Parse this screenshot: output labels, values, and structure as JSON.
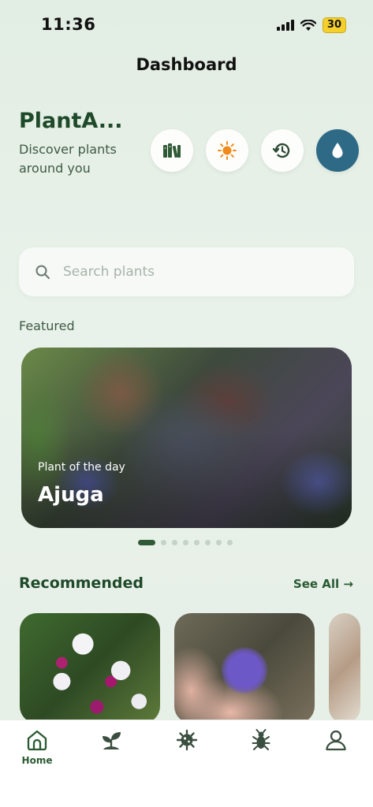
{
  "status_bar": {
    "time": "11:36",
    "battery": "30"
  },
  "header": {
    "title": "Dashboard"
  },
  "app": {
    "name": "PlantA...",
    "tagline": "Discover plants around you"
  },
  "quick_actions": [
    {
      "icon": "books-icon",
      "active": false
    },
    {
      "icon": "sun-icon",
      "active": false
    },
    {
      "icon": "history-icon",
      "active": false
    },
    {
      "icon": "water-drop-icon",
      "active": true
    }
  ],
  "search": {
    "placeholder": "Search plants",
    "value": ""
  },
  "featured": {
    "section_label": "Featured",
    "card": {
      "subtitle": "Plant of the day",
      "name": "Ajuga"
    },
    "pagination": {
      "count": 8,
      "active_index": 0
    }
  },
  "recommended": {
    "title": "Recommended",
    "see_all_label": "See All",
    "items": [
      {
        "image": "cattleya-orchid-photo"
      },
      {
        "image": "purple-flower-in-hand-photo"
      },
      {
        "image": "partial-plant-photo"
      }
    ]
  },
  "tab_bar": {
    "items": [
      {
        "icon": "home-icon",
        "label": "Home",
        "active": true
      },
      {
        "icon": "plant-sprout-icon",
        "label": "",
        "active": false
      },
      {
        "icon": "virus-icon",
        "label": "",
        "active": false
      },
      {
        "icon": "bug-icon",
        "label": "",
        "active": false
      },
      {
        "icon": "profile-icon",
        "label": "",
        "active": false
      }
    ]
  },
  "colors": {
    "primary": "#1f4a2a",
    "accent": "#2e6a86",
    "sun": "#f08a1c",
    "background": "#e6efe6"
  }
}
